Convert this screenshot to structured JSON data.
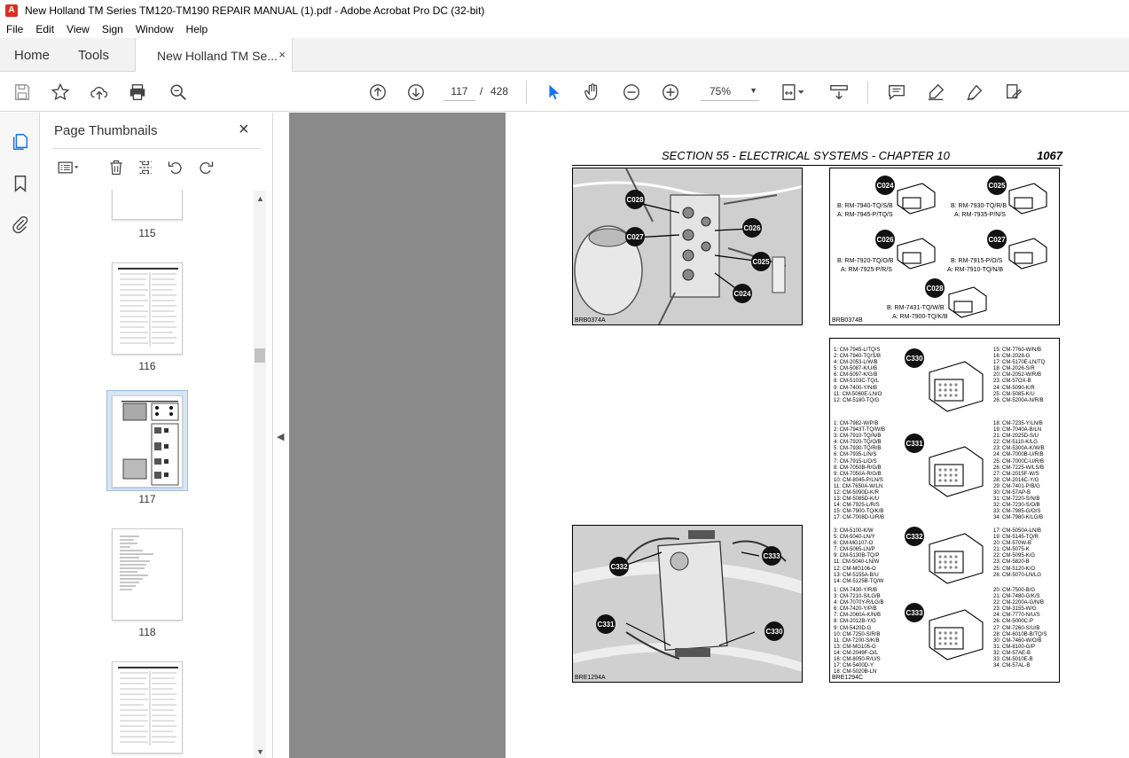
{
  "window": {
    "title": "New Holland TM Series TM120-TM190 REPAIR MANUAL (1).pdf - Adobe Acrobat Pro DC (32-bit)"
  },
  "menu": [
    "File",
    "Edit",
    "View",
    "Sign",
    "Window",
    "Help"
  ],
  "tabs": {
    "home": "Home",
    "tools": "Tools",
    "document": "New Holland TM Se...",
    "close": "×"
  },
  "toolbar": {
    "current_page": "117",
    "page_sep": "/",
    "total_pages": "428",
    "zoom": "75%"
  },
  "panel": {
    "title": "Page Thumbnails",
    "close": "×"
  },
  "thumbnails": [
    {
      "label": "115"
    },
    {
      "label": "116"
    },
    {
      "label": "117",
      "selected": true
    },
    {
      "label": "118"
    },
    {
      "label": ""
    }
  ],
  "page": {
    "section_title": "SECTION 55 - ELECTRICAL SYSTEMS - CHAPTER 10",
    "page_number": "1067",
    "fig1_label": "BRB0374A",
    "fig2_label": "BRB0374B",
    "fig3_label": "BRE1294A",
    "fig4_label": "BRE1294C",
    "fig1_badges": [
      "C028",
      "C027",
      "C026",
      "C025",
      "C024"
    ],
    "fig3_badges": [
      "C332",
      "C333",
      "C331",
      "C330"
    ],
    "connectors_top": [
      {
        "id": "C024",
        "b": "B: RM-7940-TQ/S/B",
        "a": "A: RM-7945-P/TQ/S"
      },
      {
        "id": "C025",
        "b": "B: RM-7930-TQ/R/B",
        "a": "A: RM-7935-P/N/S"
      },
      {
        "id": "C026",
        "b": "B: RM-7920-TQ/O/B",
        "a": "A: RM-7925-P/R/S"
      },
      {
        "id": "C027",
        "b": "B: RM-7915-P/O/S",
        "a": "A: RM-7910-TQ/N/B"
      },
      {
        "id": "C028",
        "b": "B: RM-7431-TQ/W/B",
        "a": "A: RM-7900-TQ/K/B"
      }
    ],
    "pin_blocks": [
      {
        "id": "C330",
        "left": "1: CM-7945-L/TQ/S\n2: CM-7940-TQ/S/B\n4: CM-2053-L/W/B\n5: CM-5087-K/U/B\n6: CM-5097-K/G/B\n8: CM-5103C-TQ/L\n9: CM-7400-Y/N/B\n11: CM-5060E-LN/O\n12: CM-5180-TQ/G",
        "right": "15: CM-7760-W/N/B\n16: CM-2028-G\n17: CM-5170E-LN/TQ\n18: CM-2026-S/R\n20: CM-2052-W/R/B\n23: CM-57OX-B\n24: CM-5090-K/R\n25: CM-5085-K/U\n26: CM-5200A-N/R/B"
      },
      {
        "id": "C331",
        "left": "1: CM-7982-W/P/B\n2: CM-7943T-TQ/W/B\n3: CM-7910-TQ/N/B\n4: CM-7920-TQ/O/B\n5: CM-7930-TQ/R/B\n6: CM-7935-L/N/S\n7: CM-7915-L/O/S\n8: CM-7050B-R/G/B\n9: CM-7050A-R/G/B\n10: CM-8045-P/LN/S\n11: CM-7650A-W/LN\n12: CM-5090D-K/R\n13: CM-5085D-K/U\n14: CM-7925-L/R/S\n15: CM-7900-TQ/K/B\n17: CM-7008D-U/R/B",
        "right": "18: CM-7235-Y/LN/B\n19: CM-7040A-B/LN\n21: CM-2025D-S/U\n22: CM-5110-K/LG\n23: CM-5300A-K/W/B\n24: CM-7000B-U/R/B\n25: CM-7000C-U/R/B\n26: CM-7225-W/LS/B\n27: CM-2015F-W/S\n28: CM-2016C-Y/G\n29: CM-7401-P/B/G\n30: CM-57AP-B\n31: CM-7220-S/N/B\n32: CM-7230-S/O/B\n33: CM-7985-G/O/S\n34: CM-7980-K/LG/B"
      },
      {
        "id": "C332",
        "left": "3: CM-5100-K/W\n5: CM-5040-LN/Y\n6: CM-MG107-O\n7: CM-5065-LN/P\n9: CM-5130B-TQ/P\n11: CM-5040-LN/W\n12: CM-MG106-O\n13: CM-5155A-B/U\n14: CM-5125B-TQ/W",
        "right": "17: CM-5050A-LN/B\n19: CM-5145-TQ/R\n20: CM-570W-B\n21: CM-5075-K\n22: CM-5095-K/G\n23: CM-5820-B\n25: CM-5120-K/O\n26: CM-5070-LN/LG"
      },
      {
        "id": "C333",
        "left": "1: CM-7430-Y/R/B\n3: CM-7210-S/LG/B\n4: CM-7070Y-R/LG/B\n6: CM-7420-Y/P/B\n7: CM-2060A-K/N/B\n8: CM-2012B-Y/O\n9: CM-5420D-G\n10: CM-7250-S/R/B\n11: CM-7200-S/K/B\n13: CM-MG105-O\n14: CM-2049F-O/L\n16: CM-8050-R/U/S\n17: CM-5400D-Y\n18: CM-5020B-LN",
        "right": "20: CM-7500-B/G\n21: CM-7480-G/K/S\n22: CM-2200A-G/N/B\n23: CM-3155-W/G\n24: CM-7770-N/U/S\n26: CM-5000C-P\n27: CM-7260-S/U/B\n28: CM-6010B-B/TQ/S\n30: CM-7460-W/O/B\n31: CM-8100-G/P\n32: CM-57AE-B\n33: CM-5010E-B\n34: CM-57AL-B"
      }
    ]
  }
}
